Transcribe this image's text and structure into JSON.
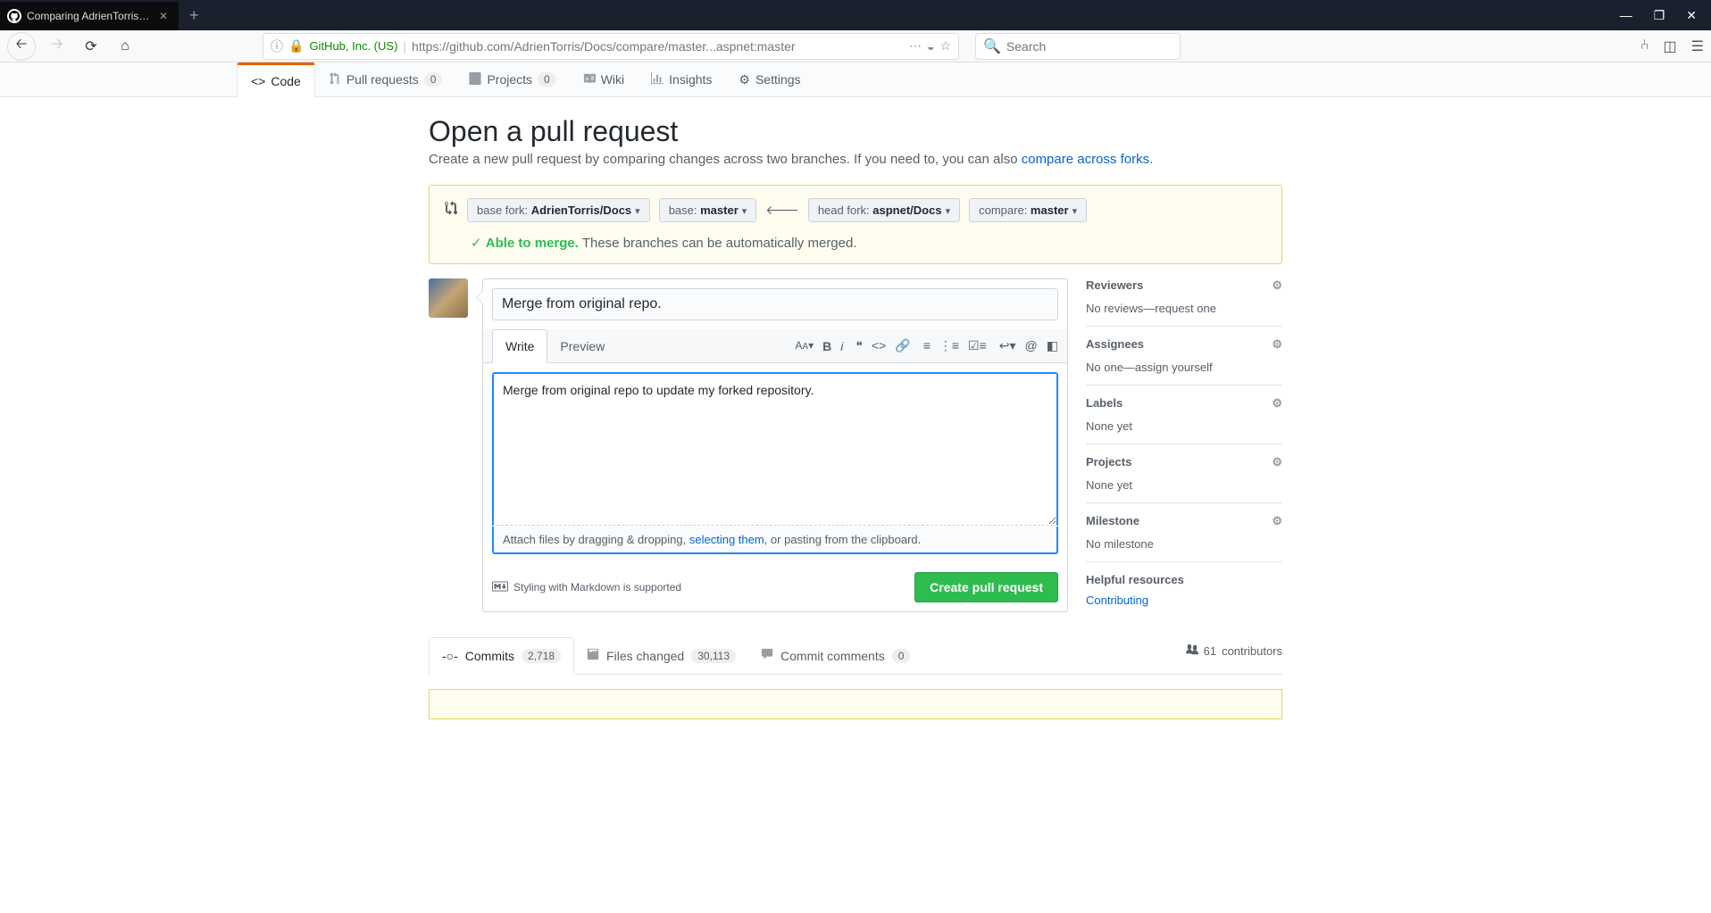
{
  "browser": {
    "tab_title": "Comparing AdrienTorris:maste",
    "url_identity": "GitHub, Inc. (US)",
    "url": "https://github.com/AdrienTorris/Docs/compare/master...aspnet:master",
    "search_placeholder": "Search"
  },
  "repo_nav": {
    "code": "Code",
    "pull_requests": "Pull requests",
    "pr_count": "0",
    "projects": "Projects",
    "projects_count": "0",
    "wiki": "Wiki",
    "insights": "Insights",
    "settings": "Settings"
  },
  "page": {
    "heading": "Open a pull request",
    "subtitle_a": "Create a new pull request by comparing changes across two branches. If you need to, you can also ",
    "subtitle_link": "compare across forks",
    "subtitle_period": "."
  },
  "compare": {
    "base_fork_label": "base fork: ",
    "base_fork_value": "AdrienTorris/Docs",
    "base_label": "base: ",
    "base_value": "master",
    "head_fork_label": "head fork: ",
    "head_fork_value": "aspnet/Docs",
    "compare_label": "compare: ",
    "compare_value": "master",
    "merge_ok": "Able to merge.",
    "merge_text": " These branches can be automatically merged."
  },
  "pr": {
    "title_value": "Merge from original repo.",
    "write": "Write",
    "preview": "Preview",
    "body_value": "Merge from original repo to update my forked repository.",
    "attach_a": "Attach files by dragging & dropping, ",
    "attach_link": "selecting them",
    "attach_b": ", or pasting from the clipboard.",
    "md_hint": "Styling with Markdown is supported",
    "create_button": "Create pull request"
  },
  "sidebar": {
    "reviewers": {
      "title": "Reviewers",
      "text": "No reviews—request one"
    },
    "assignees": {
      "title": "Assignees",
      "text": "No one—assign yourself"
    },
    "labels": {
      "title": "Labels",
      "text": "None yet"
    },
    "projects": {
      "title": "Projects",
      "text": "None yet"
    },
    "milestone": {
      "title": "Milestone",
      "text": "No milestone"
    },
    "helpful": {
      "title": "Helpful resources",
      "link": "Contributing"
    }
  },
  "diff": {
    "commits": "Commits",
    "commits_count": "2,718",
    "files": "Files changed",
    "files_count": "30,113",
    "comments": "Commit comments",
    "comments_count": "0",
    "contributors_count": "61",
    "contributors": "contributors"
  }
}
